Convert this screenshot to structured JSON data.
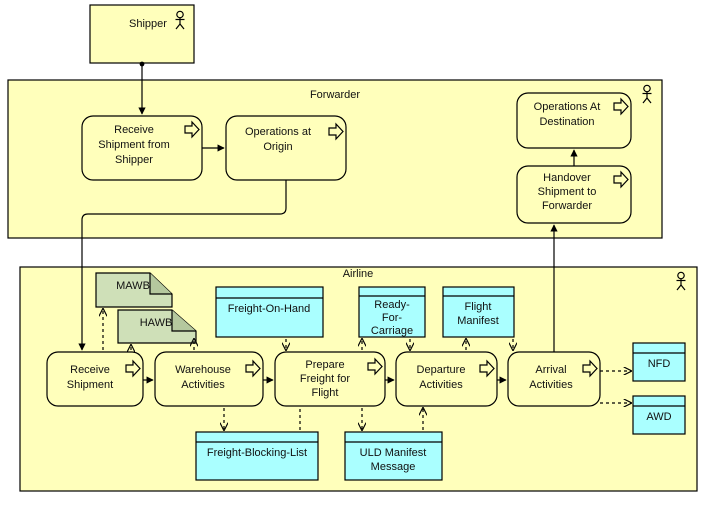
{
  "diagram": {
    "title": "Air Cargo Shipment Process Diagram",
    "colors": {
      "actor_fill": "#ffffbb",
      "lane_fill": "#ffffbb",
      "process_fill": "#ffffbb",
      "document_fill": "#cfe0b8",
      "data_object_fill": "#aaffff",
      "data_object_header": "#aaffff",
      "stroke": "#000000",
      "background": "#ffffff"
    }
  },
  "actors": [
    {
      "id": "shipper",
      "label": "Shipper",
      "icon": "actor-stick-figure-icon"
    }
  ],
  "lanes": [
    {
      "id": "forwarder",
      "label": "Forwarder",
      "icon": "actor-stick-figure-icon"
    },
    {
      "id": "airline",
      "label": "Airline",
      "icon": "actor-stick-figure-icon"
    }
  ],
  "processes": [
    {
      "id": "receive-shipment-from-shipper",
      "lane": "forwarder",
      "lines": [
        "Receive",
        "Shipment from",
        "Shipper"
      ],
      "icon": "process-arrow-icon"
    },
    {
      "id": "operations-at-origin",
      "lane": "forwarder",
      "lines": [
        "Operations at",
        "Origin"
      ],
      "icon": "process-arrow-icon"
    },
    {
      "id": "operations-at-destination",
      "lane": "forwarder",
      "lines": [
        "Operations At",
        "Destination"
      ],
      "icon": "process-arrow-icon"
    },
    {
      "id": "handover-shipment-to-forwarder",
      "lane": "forwarder",
      "lines": [
        "Handover",
        "Shipment to",
        "Forwarder"
      ],
      "icon": "process-arrow-icon"
    },
    {
      "id": "receive-shipment",
      "lane": "airline",
      "lines": [
        "Receive",
        "Shipment"
      ],
      "icon": "process-arrow-icon"
    },
    {
      "id": "warehouse-activities",
      "lane": "airline",
      "lines": [
        "Warehouse",
        "Activities"
      ],
      "icon": "process-arrow-icon"
    },
    {
      "id": "prepare-freight-for-flight",
      "lane": "airline",
      "lines": [
        "Prepare",
        "Freight for",
        "Flight"
      ],
      "icon": "process-arrow-icon"
    },
    {
      "id": "departure-activities",
      "lane": "airline",
      "lines": [
        "Departure",
        "Activities"
      ],
      "icon": "process-arrow-icon"
    },
    {
      "id": "arrival-activities",
      "lane": "airline",
      "lines": [
        "Arrival",
        "Activities"
      ],
      "icon": "process-arrow-icon"
    }
  ],
  "documents": [
    {
      "id": "mawb",
      "label": "MAWB",
      "shape": "folded-document"
    },
    {
      "id": "hawb",
      "label": "HAWB",
      "shape": "folded-document"
    }
  ],
  "data_objects": [
    {
      "id": "freight-on-hand",
      "lines": [
        "Freight-On-Hand"
      ]
    },
    {
      "id": "ready-for-carriage",
      "lines": [
        "Ready-",
        "For-",
        "Carriage"
      ]
    },
    {
      "id": "flight-manifest",
      "lines": [
        "Flight",
        "Manifest"
      ]
    },
    {
      "id": "nfd",
      "lines": [
        "NFD"
      ]
    },
    {
      "id": "awd",
      "lines": [
        "AWD"
      ]
    },
    {
      "id": "freight-blocking-list",
      "lines": [
        "Freight-Blocking-List"
      ]
    },
    {
      "id": "uld-manifest-message",
      "lines": [
        "ULD  Manifest",
        "Message"
      ]
    }
  ]
}
